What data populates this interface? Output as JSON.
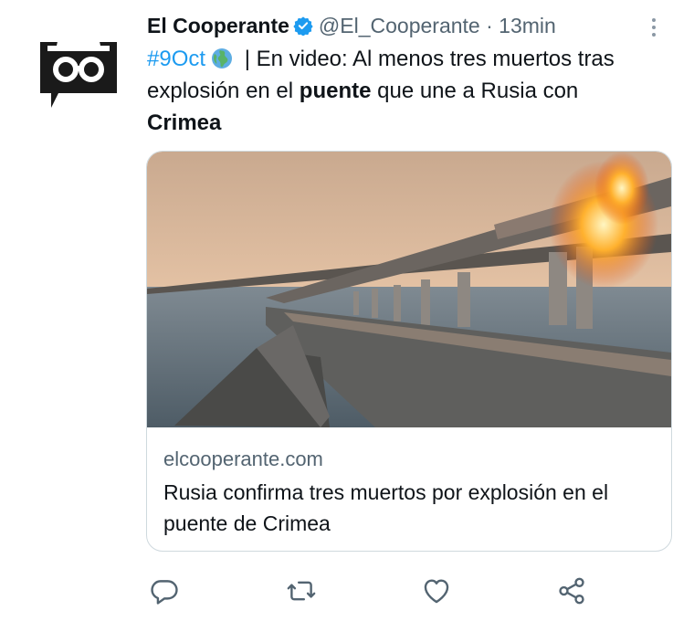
{
  "tweet": {
    "author_name": "El Cooperante",
    "handle": "@El_Cooperante",
    "separator": " · ",
    "time": "13min",
    "text": {
      "hashtag": "#9Oct",
      "pipe": " | ",
      "part1": "En video: Al menos tres muertos tras explosión en el ",
      "bold1": "puente",
      "part2": " que une a Rusia con ",
      "bold2": "Crimea"
    }
  },
  "card": {
    "domain": "elcooperante.com",
    "title": "Rusia confirma tres muertos por explosión en el puente de Crimea"
  },
  "icons": {
    "avatar": "incognito-hat-glasses-icon",
    "verified": "verified-badge-icon",
    "globe": "globe-emoji-icon",
    "more": "more-vertical-icon",
    "reply": "reply-icon",
    "retweet": "retweet-icon",
    "like": "heart-icon",
    "share": "share-icon"
  },
  "colors": {
    "link": "#1d9bf0",
    "secondary_text": "#536471",
    "action_icon": "#536471"
  }
}
